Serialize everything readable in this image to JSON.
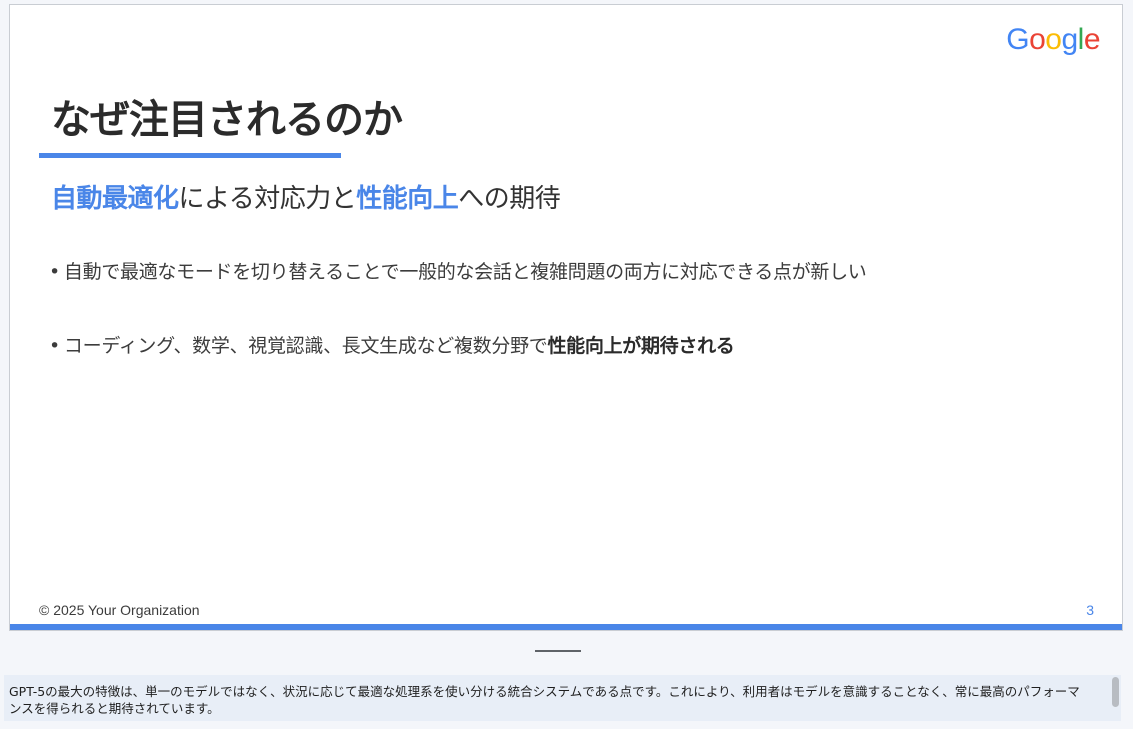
{
  "slide": {
    "logo": [
      "G",
      "o",
      "o",
      "g",
      "l",
      "e"
    ],
    "logo_colors": [
      "#4285f4",
      "#ea4335",
      "#fbbc05",
      "#4285f4",
      "#34a853",
      "#ea4335"
    ],
    "title": "なぜ注目されるのか",
    "subtitle": {
      "highlight1": "自動最適化",
      "text1": "による対応力と",
      "highlight2": "性能向上",
      "text2": "への期待"
    },
    "bullets": [
      {
        "marker": "•",
        "text": "自動で最適なモードを切り替えることで一般的な会話と複雑問題の両方に対応できる点が新しい",
        "bold": ""
      },
      {
        "marker": "•",
        "text": "コーディング、数学、視覚認識、長文生成など複数分野で",
        "bold": "性能向上が期待される"
      }
    ],
    "footer_left": "© 2025 Your Organization",
    "page_number": "3",
    "accent_color": "#4a86e8"
  },
  "notes": {
    "text": "GPT-5の最大の特徴は、単一のモデルではなく、状況に応じて最適な処理系を使い分ける統合システムである点です。これにより、利用者はモデルを意識することなく、常に最高のパフォーマンスを得られると期待されています。"
  }
}
